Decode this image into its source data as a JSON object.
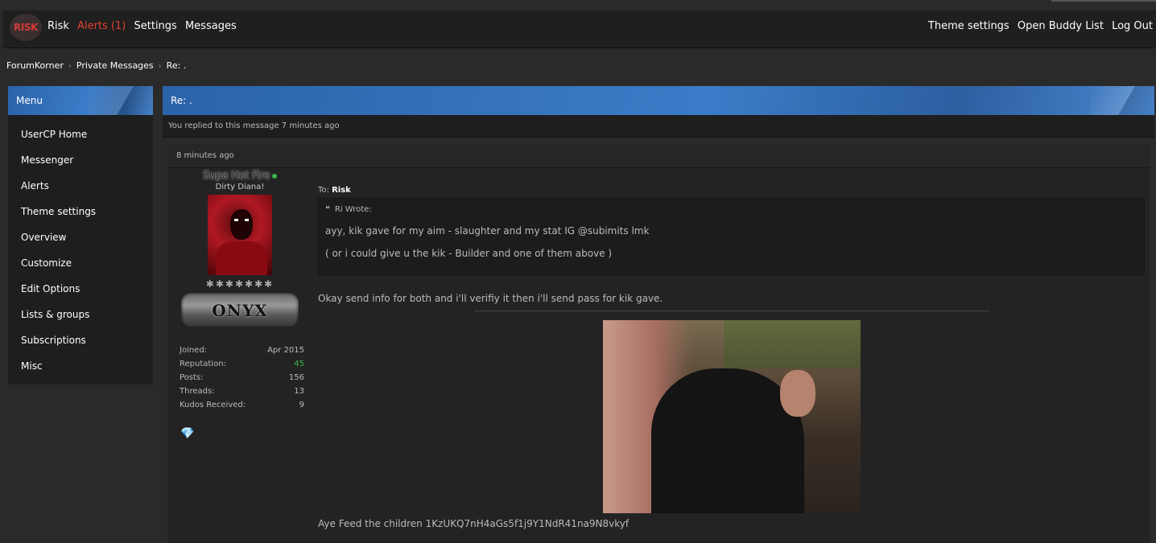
{
  "nav": {
    "logo_text": "RISK",
    "links": [
      "Risk",
      "Alerts (1)",
      "Settings",
      "Messages"
    ],
    "right_links": [
      "Theme settings",
      "Open Buddy List",
      "Log Out"
    ]
  },
  "breadcrumb": [
    "ForumKorner",
    "Private Messages",
    "Re: ."
  ],
  "sidebar": {
    "title": "Menu",
    "items": [
      "UserCP Home",
      "Messenger",
      "Alerts",
      "Theme settings",
      "Overview",
      "Customize",
      "Edit Options",
      "Lists & groups",
      "Subscriptions",
      "Misc"
    ]
  },
  "thread": {
    "title": "Re: .",
    "replied_note": "You replied to this message 7 minutes ago"
  },
  "post": {
    "time": "8 minutes ago",
    "user": {
      "name": "Supa Hot Fire",
      "usertitle": "Dirty Diana!",
      "stars": "✱✱✱✱✱✱✱",
      "rank": "ONYX",
      "stats": [
        {
          "label": "Joined:",
          "value": "Apr 2015"
        },
        {
          "label": "Reputation:",
          "value": "45"
        },
        {
          "label": "Posts:",
          "value": "156"
        },
        {
          "label": "Threads:",
          "value": "13"
        },
        {
          "label": "Kudos Received:",
          "value": "9"
        }
      ]
    },
    "to_label": "To:",
    "to_name": "Risk",
    "quote": {
      "header": "Ri Wrote:",
      "lines": [
        "ayy, kik gave for my aim - slaughter and my stat IG @subimits lmk",
        "( or i could give u the kik - Builder and one of them above )"
      ]
    },
    "body": "Okay send info for both and i'll verifiy it then i'll send pass for kik gave.",
    "footer": "Aye Feed the children 1KzUKQ7nH4aGs5f1j9Y1NdR41na9N8vkyf"
  },
  "colors": {
    "alert": "#e0432f",
    "accent_blue": "#3b7cc8",
    "online": "#3ab54a"
  }
}
